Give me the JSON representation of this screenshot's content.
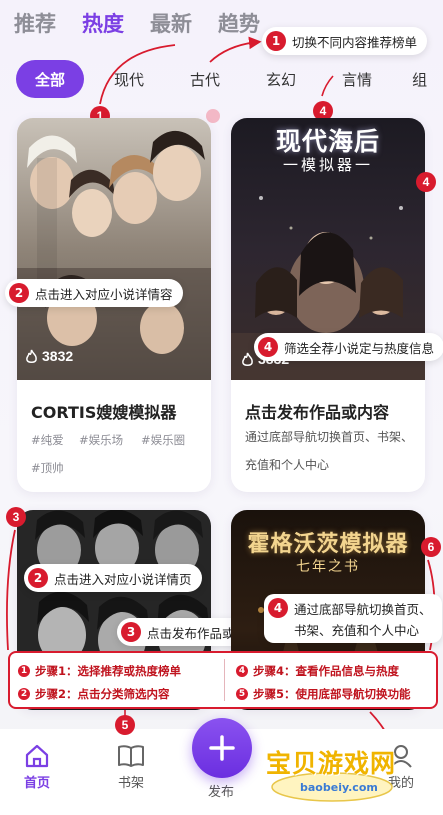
{
  "top_tabs": [
    "推荐",
    "热度",
    "最新",
    "趋势"
  ],
  "active_top_tab": "热度",
  "categories": [
    "全部",
    "现代",
    "古代",
    "玄幻",
    "言情",
    "组"
  ],
  "active_category": "全部",
  "annotations": {
    "a1_top": {
      "num": "1",
      "text": "切换不同内容推荐榜单"
    },
    "a1_chips": {
      "num": "1"
    },
    "a4_chips": {
      "num": "4"
    },
    "a2_card1": {
      "num": "2",
      "text": "点击进入对应小说详情容"
    },
    "a4_card2_text": {
      "num": "4",
      "text": "筛选全荐小说定与热度信息"
    },
    "a4_card2_right": {
      "num": "4"
    },
    "a3_left": {
      "num": "3"
    },
    "a2_card3": {
      "num": "2",
      "text": "点击进入对应小说详情页"
    },
    "a3_card3": {
      "num": "3",
      "text": "点击发布作品或内容"
    },
    "a4_card4": {
      "num": "4",
      "text_line1": "通过底部导航切换首页、",
      "text_line2": "书架、充值和个人中心"
    },
    "a6_card4": {
      "num": "6"
    },
    "a5_nav": {
      "num": "5"
    }
  },
  "cards": [
    {
      "title": "CORTIS嫂嫂模拟器",
      "tags": [
        "#纯爱",
        "#娱乐场",
        "#娱乐圈",
        "#顶帅"
      ],
      "heat": "3832"
    },
    {
      "title": "点击发布作品或内容",
      "cover_title": "现代海后",
      "cover_subtitle": "一模拟器一",
      "desc_line1": "通过底部导航切换首页、书架、",
      "desc_line2": "充值和个人中心",
      "heat": "3832"
    },
    {
      "title": "",
      "heat": ""
    },
    {
      "title": "",
      "cover_title": "霍格沃茨模拟器",
      "cover_subtitle": "七年之书"
    }
  ],
  "steps": [
    {
      "num": "1",
      "text": "步骤1：选择推荐或热度榜单"
    },
    {
      "num": "2",
      "text": "步骤2：点击分类筛选内容"
    },
    {
      "num": "4",
      "text": "步骤4：查看作品信息与热度"
    },
    {
      "num": "5",
      "text": "步骤5：使用底部导航切换功能"
    }
  ],
  "bottom_nav": [
    {
      "label": "首页",
      "icon": "home-icon"
    },
    {
      "label": "书架",
      "icon": "book-icon"
    },
    {
      "label": "发布",
      "icon": "plus-icon"
    },
    {
      "label": "我的",
      "icon": "user-icon"
    }
  ],
  "watermark": {
    "main": "宝贝游戏网",
    "sub": "baobeiy.com"
  },
  "colors": {
    "accent": "#7b3fe4",
    "annotation_red": "#d81b2e"
  }
}
